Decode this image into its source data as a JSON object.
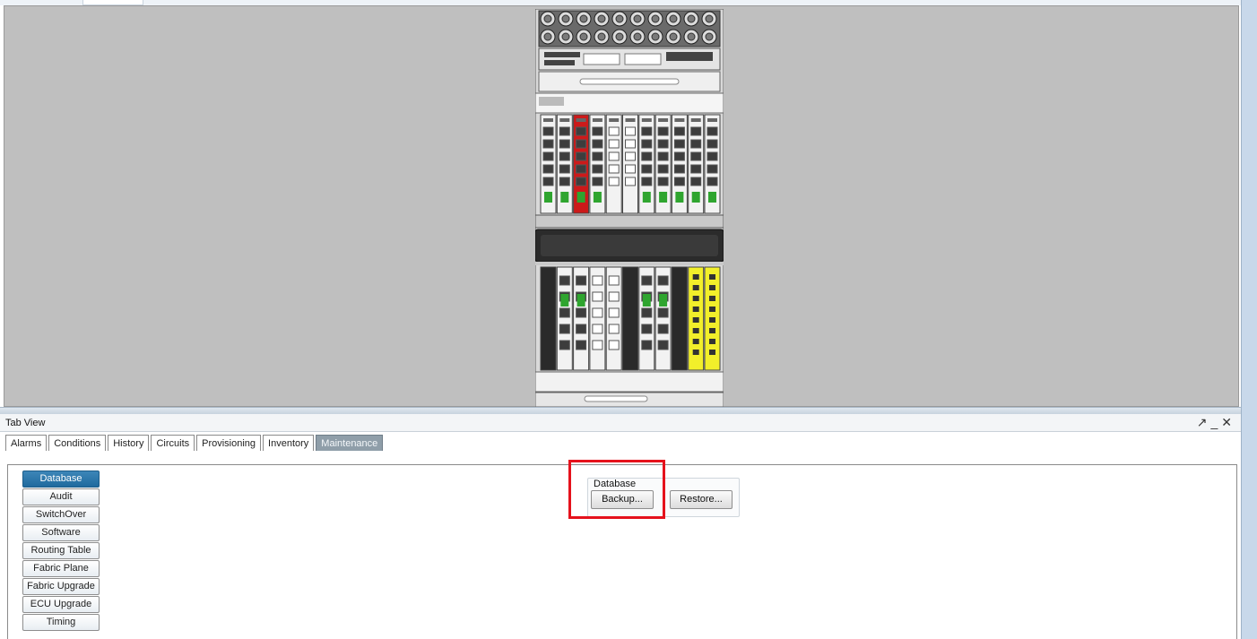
{
  "tab_view": {
    "title": "Tab View",
    "controls": {
      "float_icon": "↗",
      "minimize_icon": "_",
      "close_icon": "✕"
    }
  },
  "tabs": [
    {
      "label": "Alarms",
      "active": false
    },
    {
      "label": "Conditions",
      "active": false
    },
    {
      "label": "History",
      "active": false
    },
    {
      "label": "Circuits",
      "active": false
    },
    {
      "label": "Provisioning",
      "active": false
    },
    {
      "label": "Inventory",
      "active": false
    },
    {
      "label": "Maintenance",
      "active": true
    }
  ],
  "subtabs": [
    {
      "label": "Database",
      "active": true
    },
    {
      "label": "Audit",
      "active": false
    },
    {
      "label": "SwitchOver",
      "active": false
    },
    {
      "label": "Software",
      "active": false
    },
    {
      "label": "Routing Table",
      "active": false
    },
    {
      "label": "Fabric Plane",
      "active": false
    },
    {
      "label": "Fabric Upgrade",
      "active": false
    },
    {
      "label": "ECU Upgrade",
      "active": false
    },
    {
      "label": "Timing",
      "active": false
    }
  ],
  "database_panel": {
    "legend": "Database",
    "backup_label": "Backup...",
    "restore_label": "Restore..."
  },
  "colors": {
    "highlight": "#e5121c",
    "alarm_card": "#cc1a1a",
    "warning_card": "#f2ef2a",
    "active_tab": "#8f9ea9",
    "active_subtab": "#2a76aa",
    "shelf_bg": "#bfbfbf"
  }
}
